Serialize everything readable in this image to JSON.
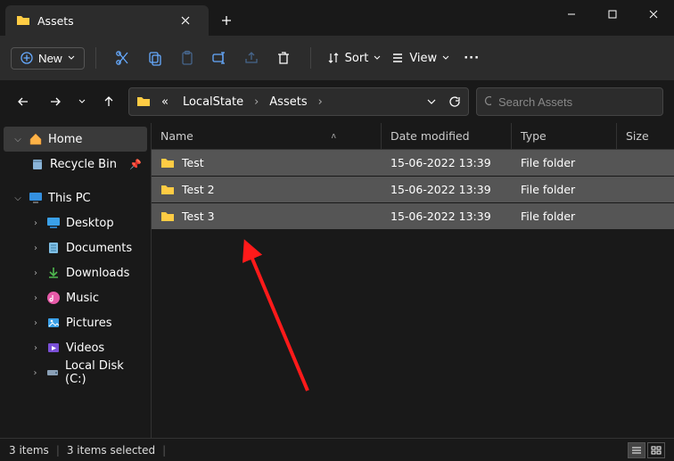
{
  "tab": {
    "title": "Assets"
  },
  "toolbar": {
    "new_label": "New",
    "sort_label": "Sort",
    "view_label": "View"
  },
  "breadcrumb": {
    "ellipsis": "«",
    "items": [
      "LocalState",
      "Assets"
    ]
  },
  "search": {
    "placeholder": "Search Assets"
  },
  "sidebar": {
    "home": "Home",
    "recycle": "Recycle Bin",
    "this_pc": "This PC",
    "desktop": "Desktop",
    "documents": "Documents",
    "downloads": "Downloads",
    "music": "Music",
    "pictures": "Pictures",
    "videos": "Videos",
    "localdisk": "Local Disk (C:)"
  },
  "columns": {
    "name": "Name",
    "date": "Date modified",
    "type": "Type",
    "size": "Size"
  },
  "rows": [
    {
      "name": "Test",
      "date": "15-06-2022 13:39",
      "type": "File folder"
    },
    {
      "name": "Test 2",
      "date": "15-06-2022 13:39",
      "type": "File folder"
    },
    {
      "name": "Test 3",
      "date": "15-06-2022 13:39",
      "type": "File folder"
    }
  ],
  "status": {
    "count": "3 items",
    "selected": "3 items selected"
  }
}
